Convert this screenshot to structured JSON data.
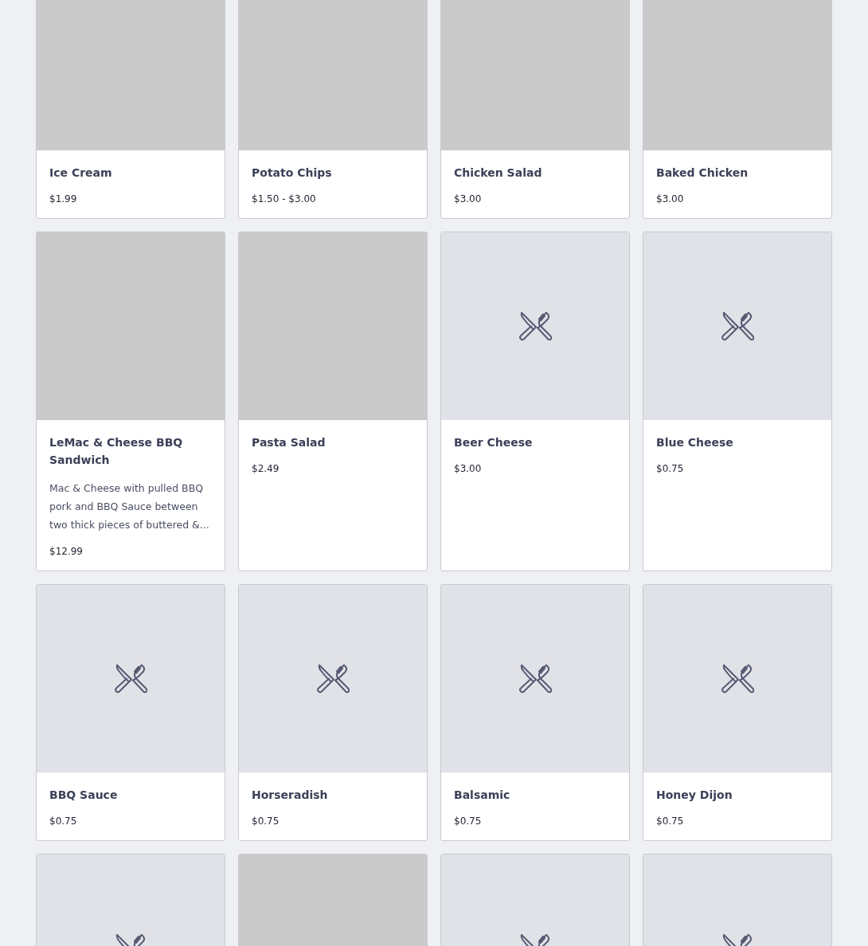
{
  "items": [
    {
      "kind": "photo",
      "name": "Ice Cream",
      "price": "$1.99"
    },
    {
      "kind": "photo",
      "name": "Potato Chips",
      "price": "$1.50 - $3.00"
    },
    {
      "kind": "photo",
      "name": "Chicken Salad",
      "price": "$3.00"
    },
    {
      "kind": "photo",
      "name": "Baked Chicken",
      "price": "$3.00"
    },
    {
      "kind": "photo",
      "name": "LeMac & Cheese BBQ Sandwich",
      "description": "Mac & Cheese with pulled BBQ pork and BBQ Sauce between two thick pieces of buttered &...",
      "price": "$12.99"
    },
    {
      "kind": "photo",
      "name": "Pasta Salad",
      "price": "$2.49"
    },
    {
      "kind": "icon",
      "name": "Beer Cheese",
      "price": "$3.00"
    },
    {
      "kind": "icon",
      "name": "Blue Cheese",
      "price": "$0.75"
    },
    {
      "kind": "icon",
      "name": "BBQ Sauce",
      "price": "$0.75"
    },
    {
      "kind": "icon",
      "name": "Horseradish",
      "price": "$0.75"
    },
    {
      "kind": "icon",
      "name": "Balsamic",
      "price": "$0.75"
    },
    {
      "kind": "icon",
      "name": "Honey Dijon",
      "price": "$0.75"
    },
    {
      "kind": "icon"
    },
    {
      "kind": "photo"
    },
    {
      "kind": "icon"
    },
    {
      "kind": "icon"
    }
  ]
}
